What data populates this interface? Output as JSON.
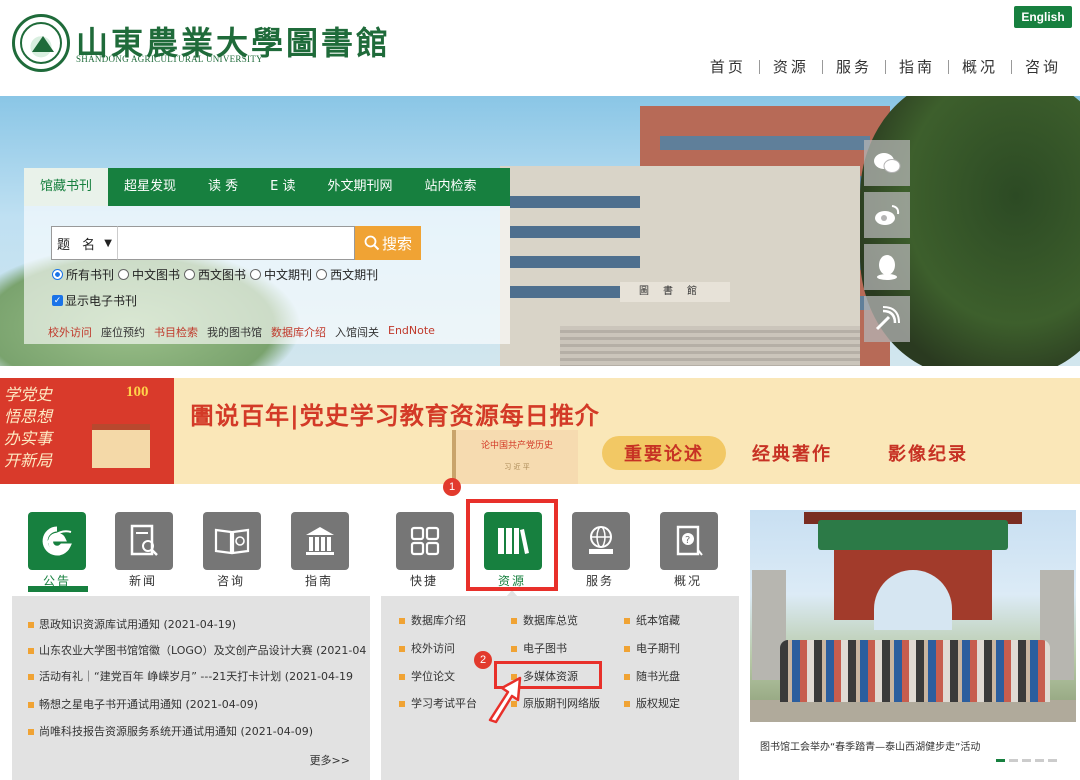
{
  "header": {
    "logo_cn": "山東農業大學圖書館",
    "logo_en": "SHANDONG AGRICULTURAL UNIVERSITY",
    "lang_button": "English",
    "nav": [
      "首页",
      "资源",
      "服务",
      "指南",
      "概况",
      "咨询"
    ]
  },
  "search": {
    "tabs": [
      "馆藏书刊",
      "超星发现",
      "读 秀",
      "E 读",
      "外文期刊网",
      "站内检索"
    ],
    "active_tab": "馆藏书刊",
    "field_select": "题 名",
    "input_value": "",
    "button_label": "搜索",
    "radios": [
      "所有书刊",
      "中文图书",
      "西文图书",
      "中文期刊",
      "西文期刊"
    ],
    "checkbox_label": "显示电子书刊",
    "quick_links": [
      "校外访问",
      "座位预约",
      "书目检索",
      "我的图书馆",
      "数据库介绍",
      "入馆闯关",
      "EndNote"
    ]
  },
  "social": [
    "wechat-icon",
    "weibo-icon",
    "qq-icon",
    "rss-icon"
  ],
  "party_banner": {
    "calligraphy": [
      "学党史",
      "悟思想",
      "办实事",
      "开新局"
    ],
    "badge": "100",
    "title": "圕说百年|党史学习教育资源每日推介",
    "book_title": "论中国共产党历史",
    "book_sub": "习 近 平",
    "tags": [
      "重要论述",
      "经典著作",
      "影像纪录"
    ]
  },
  "icon_groups": {
    "left": [
      {
        "label": "公告",
        "icon": "ie-icon",
        "active": true
      },
      {
        "label": "新闻",
        "icon": "news-icon",
        "active": false
      },
      {
        "label": "咨询",
        "icon": "book-icon",
        "active": false
      },
      {
        "label": "指南",
        "icon": "building-icon",
        "active": false
      }
    ],
    "right": [
      {
        "label": "快捷",
        "icon": "grid-icon",
        "active": false
      },
      {
        "label": "资源",
        "icon": "books-icon",
        "active": true
      },
      {
        "label": "服务",
        "icon": "globe-icon",
        "active": false
      },
      {
        "label": "概况",
        "icon": "question-book-icon",
        "active": false
      }
    ]
  },
  "annotations": [
    "1",
    "2"
  ],
  "notices": {
    "items": [
      "思政知识资源库试用通知 (2021-04-19)",
      "山东农业大学图书馆馆徽（LOGO）及文创产品设计大赛 (2021-04",
      "活动有礼｜“建党百年 峥嵘岁月” ---21天打卡计划 (2021-04-19",
      "畅想之星电子书开通试用通知 (2021-04-09)",
      "尚唯科技报告资源服务系统开通试用通知 (2021-04-09)"
    ],
    "more": "更多>>"
  },
  "resources": {
    "col1": [
      "数据库介绍",
      "校外访问",
      "学位论文",
      "学习考试平台"
    ],
    "col2": [
      "数据库总览",
      "电子图书",
      "多媒体资源",
      "原版期刊网络版"
    ],
    "col3": [
      "纸本馆藏",
      "电子期刊",
      "随书光盘",
      "版权规定"
    ]
  },
  "photo_news": {
    "caption": "图书馆工会举办“春季踏青—泰山西湖健步走”活动",
    "slide_count": 5,
    "active_slide": 1
  },
  "colors": {
    "brand_green": "#17803f",
    "accent_orange": "#f0a334",
    "annotation_red": "#e8302a",
    "party_red": "#d33a27"
  }
}
